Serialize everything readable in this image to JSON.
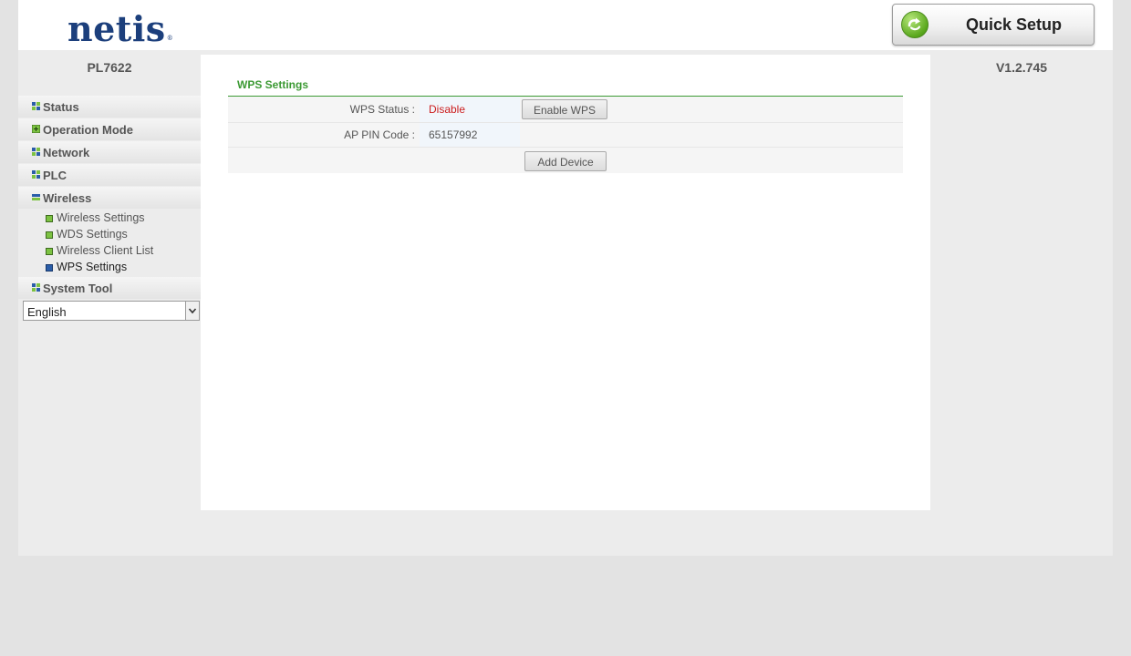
{
  "brand": {
    "logo_text": "netis",
    "registered_mark": "®"
  },
  "header": {
    "quick_setup_label": "Quick Setup"
  },
  "device": {
    "model": "PL7622",
    "firmware_version": "V1.2.745"
  },
  "sidebar": {
    "items": [
      {
        "label": "Status"
      },
      {
        "label": "Operation Mode"
      },
      {
        "label": "Network"
      },
      {
        "label": "PLC"
      },
      {
        "label": "Wireless"
      },
      {
        "label": "System Tool"
      }
    ],
    "wireless_subitems": [
      {
        "label": "Wireless Settings"
      },
      {
        "label": "WDS Settings"
      },
      {
        "label": "Wireless Client List"
      },
      {
        "label": "WPS Settings"
      }
    ],
    "language": {
      "selected": "English"
    }
  },
  "main": {
    "section_title": "WPS Settings",
    "wps_status": {
      "label": "WPS Status :",
      "value": "Disable",
      "button_label": "Enable WPS"
    },
    "ap_pin": {
      "label": "AP PIN Code :",
      "value": "65157992"
    },
    "add_device_label": "Add Device"
  },
  "colors": {
    "accent_green": "#3c9a34",
    "status_red": "#cc1f1f",
    "logo_blue": "#1c3f7c"
  }
}
